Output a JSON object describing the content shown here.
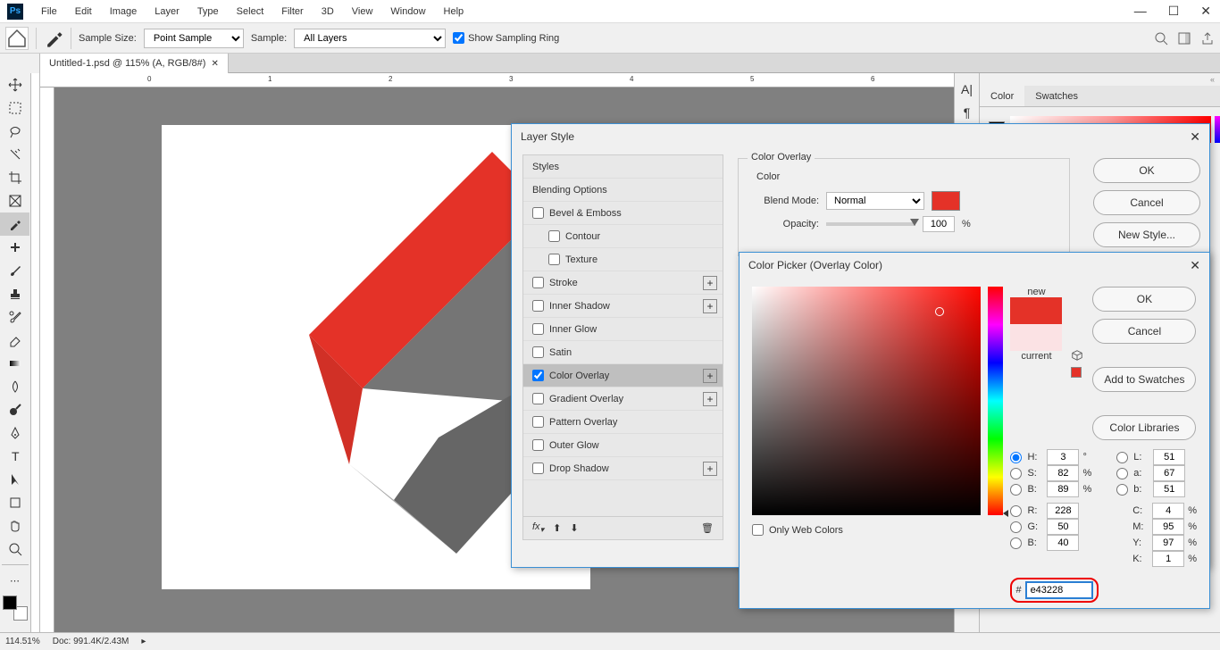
{
  "menu": {
    "items": [
      "File",
      "Edit",
      "Image",
      "Layer",
      "Type",
      "Select",
      "Filter",
      "3D",
      "View",
      "Window",
      "Help"
    ]
  },
  "optbar": {
    "sample_size_label": "Sample Size:",
    "sample_size_value": "Point Sample",
    "sample_label": "Sample:",
    "sample_value": "All Layers",
    "show_ring": "Show Sampling Ring"
  },
  "tab": {
    "title": "Untitled-1.psd @ 115% (A, RGB/8#)"
  },
  "panels": {
    "color": "Color",
    "swatches": "Swatches"
  },
  "layerStyle": {
    "title": "Layer Style",
    "styles": "Styles",
    "blendingOptions": "Blending Options",
    "bevel": "Bevel & Emboss",
    "contour": "Contour",
    "texture": "Texture",
    "stroke": "Stroke",
    "innerShadow": "Inner Shadow",
    "innerGlow": "Inner Glow",
    "satin": "Satin",
    "colorOverlay": "Color Overlay",
    "gradientOverlay": "Gradient Overlay",
    "patternOverlay": "Pattern Overlay",
    "outerGlow": "Outer Glow",
    "dropShadow": "Drop Shadow",
    "okBtn": "OK",
    "cancelBtn": "Cancel",
    "newStyleBtn": "New Style...",
    "section": "Color Overlay",
    "colorLabel": "Color",
    "blendModeLabel": "Blend Mode:",
    "blendModeValue": "Normal",
    "opacityLabel": "Opacity:",
    "opacityValue": "100",
    "opacityUnit": "%"
  },
  "picker": {
    "title": "Color Picker (Overlay Color)",
    "ok": "OK",
    "cancel": "Cancel",
    "addSwatch": "Add to Swatches",
    "libraries": "Color Libraries",
    "new": "new",
    "current": "current",
    "webColors": "Only Web Colors",
    "H": "H:",
    "S": "S:",
    "B": "B:",
    "R": "R:",
    "G": "G:",
    "Bb": "B:",
    "L": "L:",
    "a": "a:",
    "b": "b:",
    "C": "C:",
    "M": "M:",
    "Y": "Y:",
    "K": "K:",
    "Hv": "3",
    "Sv": "82",
    "Bv": "89",
    "Rv": "228",
    "Gv": "50",
    "Bbv": "40",
    "Lv": "51",
    "av": "67",
    "bv": "51",
    "Cv": "4",
    "Mv": "95",
    "Yv": "97",
    "Kv": "1",
    "hex": "e43228",
    "deg": "°",
    "pct": "%",
    "hash": "#"
  },
  "status": {
    "zoom": "114.51%",
    "doc": "Doc: 991.4K/2.43M"
  },
  "ruler": {
    "ticks": [
      "0",
      "1",
      "2",
      "3",
      "4",
      "5",
      "6"
    ]
  }
}
